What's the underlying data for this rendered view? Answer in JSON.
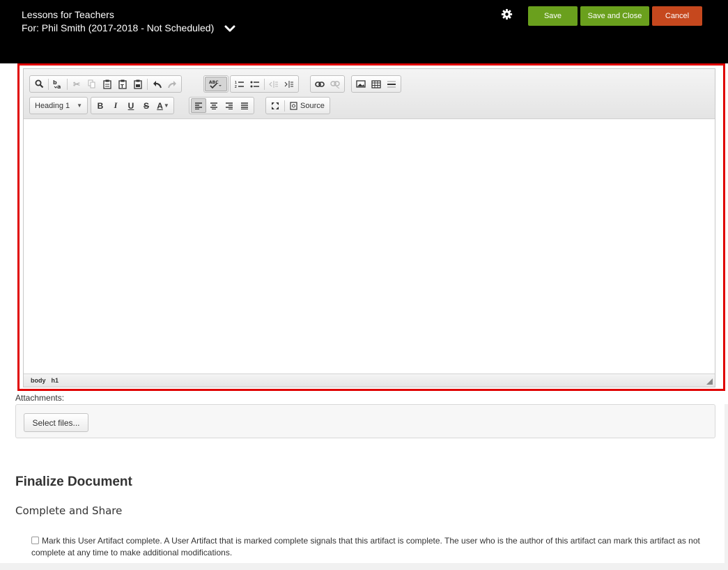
{
  "header": {
    "title": "Lessons for Teachers",
    "subtitle": "For: Phil Smith (2017-2018 - Not Scheduled)",
    "save_label": "Save",
    "save_close_label": "Save and Close",
    "cancel_label": "Cancel",
    "colors": {
      "save": "#6aa01d",
      "cancel": "#c6481e"
    }
  },
  "editor": {
    "format_combo": "Heading 1",
    "source_label": "Source",
    "bold": "B",
    "italic": "I",
    "underline": "U",
    "strike": "S",
    "textcolor": "A",
    "path": [
      "body",
      "h1"
    ]
  },
  "attachments": {
    "label": "Attachments:",
    "select_label": "Select files..."
  },
  "finalize": {
    "title": "Finalize Document",
    "subtitle": "Complete and Share",
    "checkbox_text": "Mark this User Artifact complete. A User Artifact that is marked complete signals that this artifact is complete. The user who is the author of this artifact can mark this artifact as not complete at any time to make additional modifications."
  }
}
